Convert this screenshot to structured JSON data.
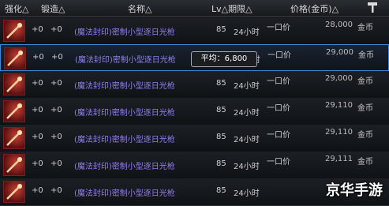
{
  "header": {
    "col_enhance": "强化△",
    "col_forge": "锻造△",
    "col_name": "名称△",
    "col_level_period": "Lv△期限△",
    "col_price": "价格(金币)△"
  },
  "rows": [
    {
      "enhance": "+0",
      "forge": "+0",
      "name": "(魔法封印)密制小型逐日光枪",
      "level": "85",
      "period": "24小时",
      "sale_type": "一口价",
      "price": "28,000",
      "currency": "金币"
    },
    {
      "enhance": "+0",
      "forge": "+0",
      "name": "(魔法封印)密制小型逐日光枪",
      "level": "85",
      "period": "24小时",
      "sale_type": "一口价",
      "price": "29,000",
      "currency": "金币"
    },
    {
      "enhance": "+0",
      "forge": "+0",
      "name": "(魔法封印)密制小型逐日光枪",
      "level": "85",
      "period": "24小时",
      "sale_type": "一口价",
      "price": "29,000",
      "currency": "金币"
    },
    {
      "enhance": "+0",
      "forge": "+0",
      "name": "(魔法封印)密制小型逐日光枪",
      "level": "85",
      "period": "24小时",
      "sale_type": "一口价",
      "price": "29,110",
      "currency": "金币"
    },
    {
      "enhance": "+0",
      "forge": "+0",
      "name": "(魔法封印)密制小型逐日光枪",
      "level": "85",
      "period": "24小时",
      "sale_type": "一口价",
      "price": "29,110",
      "currency": "金币"
    },
    {
      "enhance": "+0",
      "forge": "+0",
      "name": "(魔法封印)密制小型逐日光枪",
      "level": "85",
      "period": "24小时",
      "sale_type": "一口价",
      "price": "29,111",
      "currency": "金币"
    },
    {
      "enhance": "+0",
      "forge": "+0",
      "name": "(魔法封印)密制小型逐日光枪",
      "level": "85",
      "period": "24小时",
      "sale_type": "",
      "price": "",
      "currency": ""
    }
  ],
  "tooltip": {
    "text": "平均：6,800"
  },
  "watermark": {
    "text": "京华手游"
  },
  "colors": {
    "name": "#8f7ff0",
    "selected_border": "#3f86d8",
    "icon": "#c74134"
  },
  "icons": {
    "row_item": "red-lance-icon",
    "header_right": "hammer-icon"
  }
}
